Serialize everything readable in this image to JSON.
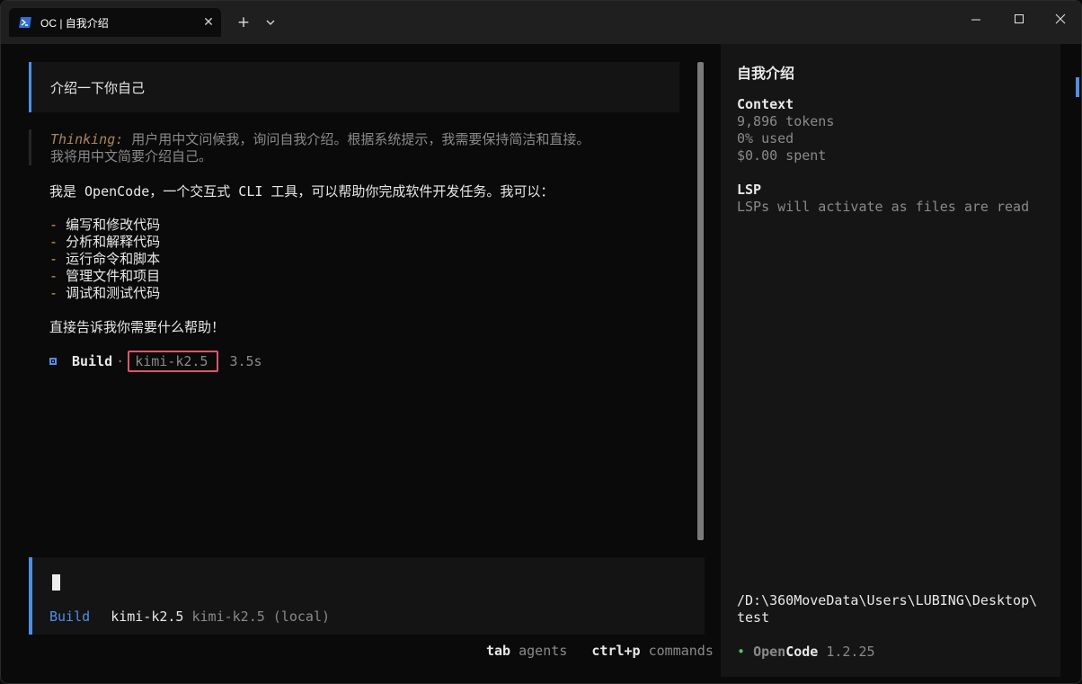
{
  "window": {
    "tab_title": "OC | 自我介绍",
    "close_tab_glyph": "✕",
    "new_tab_glyph": "+"
  },
  "conversation": {
    "user_message": "介绍一下你自己",
    "thinking_label": "Thinking:",
    "thinking_line1": " 用户用中文问候我，询问自我介绍。根据系统提示，我需要保持简洁和直接。",
    "thinking_line2": "我将用中文简要介绍自己。",
    "intro": "我是 OpenCode，一个交互式 CLI 工具，可以帮助你完成软件开发任务。我可以：",
    "bullet_marker": "-",
    "bullets": [
      "编写和修改代码",
      "分析和解释代码",
      "运行命令和脚本",
      "管理文件和项目",
      "调试和测试代码"
    ],
    "closing": "直接告诉我你需要什么帮助！",
    "build": {
      "label": "Build",
      "separator": "·",
      "model": "kimi-k2.5",
      "duration": "3.5s"
    }
  },
  "input": {
    "agent": "Build",
    "model": "kimi-k2.5",
    "provider": "kimi-k2.5 (local)"
  },
  "hints": {
    "tab_key": "tab",
    "tab_desc": "agents",
    "cmd_key": "ctrl+p",
    "cmd_desc": "commands"
  },
  "sidebar": {
    "title": "自我介绍",
    "context_heading": "Context",
    "tokens": "9,896 tokens",
    "used": "0% used",
    "spent": "$0.00 spent",
    "lsp_heading": "LSP",
    "lsp_status": "LSPs will activate as files are read",
    "path_line1": "/D:\\360MoveData\\Users\\LUBING\\Desktop\\",
    "path_line2": "test",
    "status_dot": "•",
    "brand_open": "Open",
    "brand_code": "Code",
    "version": "1.2.25"
  },
  "colors": {
    "accent": "#4f8fe6",
    "bullet": "#e39b4a",
    "highlight_box": "#e0566a",
    "status_ok": "#5fb86a"
  }
}
